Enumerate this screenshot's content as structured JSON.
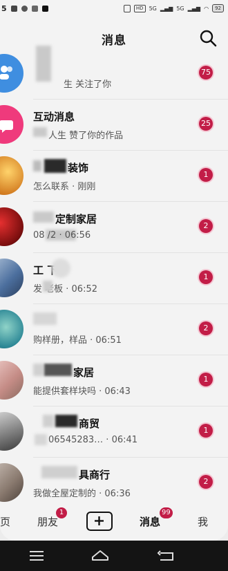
{
  "status_bar": {
    "time_fragment": "5",
    "chips": [
      "HD",
      "5G",
      "5G"
    ],
    "battery": "92"
  },
  "header": {
    "title": "消息",
    "search_icon": "search-icon"
  },
  "messages": [
    {
      "name": "",
      "preview": "生 关注了你",
      "badge": "75",
      "avatar_color": "#3f8ee0"
    },
    {
      "name": "互动消息",
      "preview": "人生 赞了你的作品",
      "badge": "25",
      "avatar_color": "#ef3a7c"
    },
    {
      "name": "装饰",
      "preview": "怎么联系 · 刚刚",
      "badge": "1",
      "avatar_color": "#e6a53a"
    },
    {
      "name": "定制家居",
      "preview": "08 /2 · 06:56",
      "badge": "2",
      "avatar_color": "#8c1c1c"
    },
    {
      "name": "工 下",
      "preview": "发 老板 · 06:52",
      "badge": "1",
      "avatar_color": "#5d7fb0"
    },
    {
      "name": "",
      "preview": "购样册，样品 · 06:51",
      "badge": "2",
      "avatar_color": "#4f9fae"
    },
    {
      "name": "家居",
      "preview": "能提供套样块吗 · 06:43",
      "badge": "1",
      "avatar_color": "#d9a5a0"
    },
    {
      "name": "商贸",
      "preview": "06545283… · 06:41",
      "badge": "1",
      "avatar_color": "#8a8a8a"
    },
    {
      "name": "具商行",
      "preview": "我做全屋定制的 · 06:36",
      "badge": "2",
      "avatar_color": "#9c8f86"
    }
  ],
  "tabbar": {
    "home": "页",
    "friends": "朋友",
    "friends_badge": "1",
    "messages": "消息",
    "messages_badge": "99",
    "me": "我"
  },
  "colors": {
    "badge": "#c21d47",
    "nav_bar": "#141414"
  }
}
